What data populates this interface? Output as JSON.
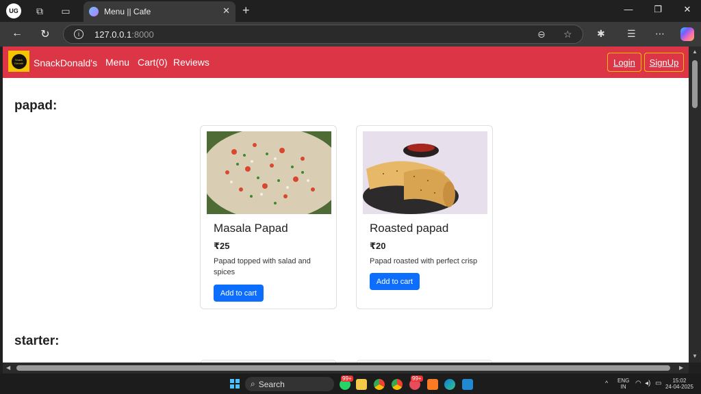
{
  "browser": {
    "profile_label": "UG",
    "tab_title": "Menu || Cafe",
    "url_host": "127.0.0.1",
    "url_port": ":8000"
  },
  "navbar": {
    "brand": "SnackDonald's",
    "logo_text": "Snack Donald",
    "links": [
      "Menu",
      "Cart(0)",
      "Reviews"
    ],
    "login": "Login",
    "signup": "SignUp"
  },
  "sections": [
    {
      "title": "papad:",
      "items": [
        {
          "name": "Masala Papad",
          "price": "₹25",
          "description": "Papad topped with salad and spices",
          "button": "Add to cart"
        },
        {
          "name": "Roasted papad",
          "price": "₹20",
          "description": "Papad roasted with perfect crisp",
          "button": "Add to cart"
        }
      ]
    },
    {
      "title": "starter:",
      "items": []
    }
  ],
  "taskbar": {
    "search_label": "Search",
    "lang_top": "ENG",
    "lang_bottom": "IN",
    "time": "15:02",
    "date": "24-04-2025",
    "badge": "99+"
  },
  "colors": {
    "navbar": "#dc3545",
    "button": "#0d6efd",
    "auth_border": "#ffc107"
  }
}
